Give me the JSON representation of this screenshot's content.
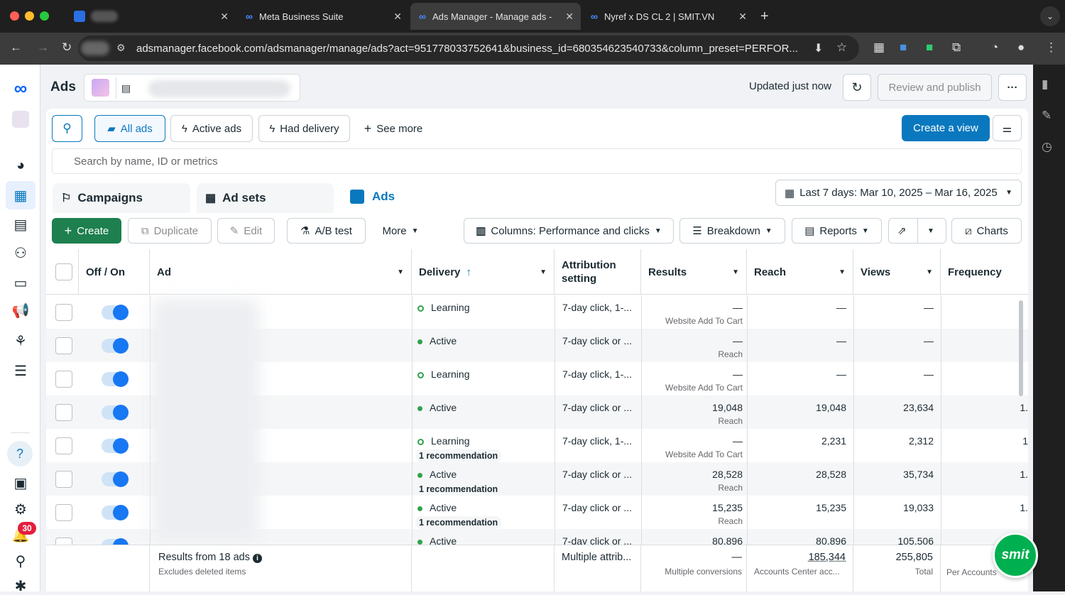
{
  "browser": {
    "tabs": [
      {
        "label": ""
      },
      {
        "label": "Meta Business Suite"
      },
      {
        "label": "Ads Manager - Manage ads -"
      },
      {
        "label": "Nyref x DS CL 2 | SMIT.VN"
      }
    ],
    "url": "adsmanager.facebook.com/adsmanager/manage/ads?act=951778033752641&business_id=680354623540733&column_preset=PERFOR..."
  },
  "colors": {
    "primary": "#0866ff",
    "accent": "#0a78be",
    "success": "#31a24c",
    "badge": "#e41e3f",
    "smit": "#00b050"
  },
  "header": {
    "title": "Ads",
    "updated": "Updated just now",
    "review": "Review and publish",
    "more": "···"
  },
  "filters": {
    "all_ads": "All ads",
    "active_ads": "Active ads",
    "had_delivery": "Had delivery",
    "see_more": "See more",
    "create_view": "Create a view",
    "search_placeholder": "Search by name, ID or metrics"
  },
  "levels": {
    "campaigns": "Campaigns",
    "adsets": "Ad sets",
    "ads": "Ads",
    "date": "Last 7 days: Mar 10, 2025 – Mar 16, 2025"
  },
  "toolbar": {
    "create": "Create",
    "duplicate": "Duplicate",
    "edit": "Edit",
    "abtest": "A/B test",
    "more": "More",
    "columns": "Columns: Performance and clicks",
    "breakdown": "Breakdown",
    "reports": "Reports",
    "charts": "Charts"
  },
  "columns": {
    "offon": "Off / On",
    "ad": "Ad",
    "delivery": "Delivery",
    "attribution": "Attribution setting",
    "results": "Results",
    "reach": "Reach",
    "views": "Views",
    "frequency": "Frequency"
  },
  "rows": [
    {
      "delivery": "Learning",
      "learning": true,
      "rec": "",
      "attr": "7-day click, 1-...",
      "results": "—",
      "results_sub": "Website Add To Cart",
      "reach": "—",
      "views": "—",
      "freq": ""
    },
    {
      "delivery": "Active",
      "learning": false,
      "rec": "",
      "attr": "7-day click or ...",
      "results": "—",
      "results_sub": "Reach",
      "reach": "—",
      "views": "—",
      "freq": ""
    },
    {
      "delivery": "Learning",
      "learning": true,
      "rec": "",
      "attr": "7-day click, 1-...",
      "results": "—",
      "results_sub": "Website Add To Cart",
      "reach": "—",
      "views": "—",
      "freq": ""
    },
    {
      "delivery": "Active",
      "learning": false,
      "rec": "",
      "attr": "7-day click or ...",
      "results": "19,048",
      "results_sub": "Reach",
      "reach": "19,048",
      "views": "23,634",
      "freq": "1."
    },
    {
      "delivery": "Learning",
      "learning": true,
      "rec": "1 recommendation",
      "attr": "7-day click, 1-...",
      "results": "—",
      "results_sub": "Website Add To Cart",
      "reach": "2,231",
      "views": "2,312",
      "freq": "1"
    },
    {
      "delivery": "Active",
      "learning": false,
      "rec": "1 recommendation",
      "attr": "7-day click or ...",
      "results": "28,528",
      "results_sub": "Reach",
      "reach": "28,528",
      "views": "35,734",
      "freq": "1."
    },
    {
      "delivery": "Active",
      "learning": false,
      "rec": "1 recommendation",
      "attr": "7-day click or ...",
      "results": "15,235",
      "results_sub": "Reach",
      "reach": "15,235",
      "views": "19,033",
      "freq": "1."
    },
    {
      "delivery": "Active",
      "learning": false,
      "rec": "",
      "attr": "7-day click or ...",
      "results": "80,896",
      "results_sub": "",
      "reach": "80,896",
      "views": "105,506",
      "freq": ""
    }
  ],
  "footer": {
    "title": "Results from 18 ads",
    "sub": "Excludes deleted items",
    "attr": "Multiple attrib...",
    "results": "—",
    "results_sub": "Multiple conversions",
    "reach": "185,344",
    "reach_sub": "Accounts Center acc...",
    "views": "255,805",
    "views_sub": "Total",
    "freq_sub": "Per Accounts"
  },
  "nav": {
    "badge": "30"
  },
  "smit": "smit"
}
